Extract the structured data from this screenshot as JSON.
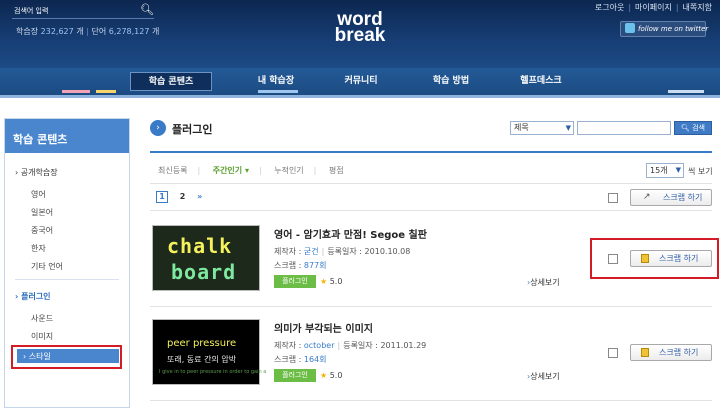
{
  "header": {
    "search_label": "검색어 입력",
    "stats": {
      "learned_label": "학습장",
      "learned_count": "232,627",
      "learned_unit": "개",
      "words_label": "단어",
      "words_count": "6,278,127",
      "words_unit": "개"
    },
    "logo_line1": "word",
    "logo_line2": "break",
    "top_links": [
      "로그아웃",
      "마이페이지",
      "내쪽지함"
    ],
    "twitter_label": "follow me on twitter"
  },
  "nav": {
    "items": [
      "학습 콘텐츠",
      "내 학습장",
      "커뮤니티",
      "학습 방법",
      "헬프데스크"
    ],
    "active_index": 0
  },
  "sidebar": {
    "title": "학습 콘텐츠",
    "section1": "공개학습장",
    "section1_items": [
      "영어",
      "일본어",
      "중국어",
      "한자",
      "기타 언어"
    ],
    "section2": "플러그인",
    "section2_items": [
      "사운드",
      "이미지",
      "스타일"
    ],
    "selected_item": "스타일"
  },
  "main": {
    "page_title": "플러그인",
    "search": {
      "field_select": "제목",
      "query": "",
      "button": "검색"
    },
    "tabs": [
      "최신등록",
      "주간인기",
      "누적인기",
      "평점"
    ],
    "active_tab": "주간인기",
    "per_page": "15개",
    "per_page_suffix": "씩 보기",
    "pager": {
      "pages": [
        "1",
        "2"
      ],
      "current": "1",
      "next": "»"
    },
    "scrap_all_label": "스크랩 하기",
    "items": [
      {
        "title": "영어 - 암기효과 만점! Segoe 칠판",
        "author_label": "제작자 :",
        "author": "굳건",
        "date_label": "등록일자 :",
        "date": "2010.10.08",
        "scrap_label": "스크랩 :",
        "scrap_count": "877회",
        "badge": "플러그인",
        "rating": "5.0",
        "detail": "상세보기",
        "button": "스크랩 하기",
        "thumb_text1": "chalk",
        "thumb_text2": "board"
      },
      {
        "title": "의미가 부각되는 이미지",
        "author_label": "제작자 :",
        "author": "october",
        "date_label": "등록일자 :",
        "date": "2011.01.29",
        "scrap_label": "스크랩 :",
        "scrap_count": "164회",
        "badge": "플러그인",
        "rating": "5.0",
        "detail": "상세보기",
        "button": "스크랩 하기",
        "thumb_text1": "peer pressure",
        "thumb_text2": "또래, 동료 간의 압박",
        "thumb_text3": "I give in to peer pressure in order to gain a"
      }
    ]
  },
  "colors": {
    "header_bg": "#173e75",
    "accent_blue": "#3a7bc8",
    "sidebar_head": "#4a86cd",
    "badge_green": "#6cbd45",
    "highlight_red": "#d41c26"
  }
}
